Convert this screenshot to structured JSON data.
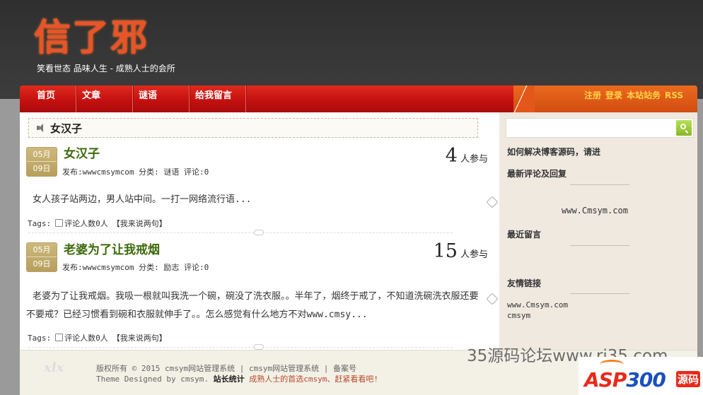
{
  "header": {
    "logo_text": "信了邪",
    "tagline": "笑看世态 品味人生 - 成熟人士的会所"
  },
  "nav": {
    "items": [
      {
        "label": "首页"
      },
      {
        "label": "文章"
      },
      {
        "label": "谜语"
      },
      {
        "label": "给我留言"
      }
    ],
    "links": [
      {
        "label": "注册"
      },
      {
        "label": "登录"
      },
      {
        "label": "本站站务"
      },
      {
        "label": "RSS"
      }
    ]
  },
  "breadcrumb": {
    "title": "女汉子",
    "icon": "speaker-icon"
  },
  "posts": [
    {
      "month": "05月",
      "day": "09日",
      "title": "女汉子",
      "meta": "发布:wwwcmsymcom 分类: 谜语 评论:0",
      "count": "4",
      "count_label": "人参与",
      "excerpt": "女人孩子站两边，男人站中间。一打一网络流行语...",
      "tags_label": "Tags:",
      "comments_label": "评论人数0人",
      "reply_label": "【我来说两句】"
    },
    {
      "month": "05月",
      "day": "09日",
      "title": "老婆为了让我戒烟",
      "meta": "发布:wwwcmsymcom 分类: 励志 评论:0",
      "count": "15",
      "count_label": "人参与",
      "excerpt": "老婆为了让我戒烟。我吸一根就叫我洗一个碗，碗没了洗衣服。。半年了，烟终于戒了，不知道洗碗洗衣服还要不要戒？已经习惯看到碗和衣服就伸手了。。怎么感觉有什么地方不对www.cmsy...",
      "tags_label": "Tags:",
      "comments_label": "评论人数0人",
      "reply_label": "【我来说两句】"
    }
  ],
  "sidebar": {
    "search_value": "",
    "search_icon": "search-icon",
    "headings": {
      "howto": "如何解决博客源码，请进",
      "latest_comments": "最新评论及回复",
      "recent_messages": "最近留言",
      "friend_links": "友情链接"
    },
    "latest_comments_text": "www.Cmsym.com",
    "friend_links": [
      "www.Cmsym.com",
      "cmsym"
    ]
  },
  "footer": {
    "logo": "xlx",
    "line1": "版权所有 © 2015 cmsym网站管理系统 | cmsym网站管理系统 | 备案号",
    "line2_prefix": "Theme Designed by cmsym.",
    "line2_stat": "站长统计",
    "line2_slogan": "成熟人士的首选cmsym、赶紧看看吧!"
  },
  "watermark": {
    "text": "35源码论坛www.ri35.com",
    "asp_red": "ASP",
    "asp_blue": "300",
    "asp_badge": "源码"
  },
  "colors": {
    "nav_red": "#c20f0f",
    "nav_orange": "#d24c10",
    "title_green": "#3e6a0e",
    "date_gold": "#b79f5c",
    "link_yellow": "#ffd24a"
  }
}
